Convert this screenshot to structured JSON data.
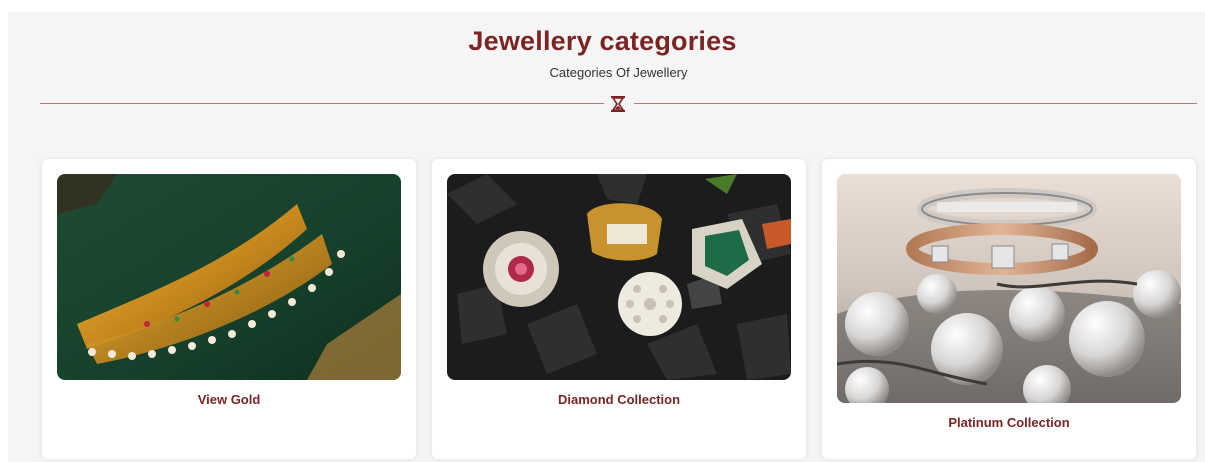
{
  "header": {
    "title": "Jewellery categories",
    "subtitle": "Categories Of Jewellery",
    "divider_icon": "hourglass-icon",
    "accent_color": "#7a2524"
  },
  "categories": [
    {
      "label": "View Gold",
      "image": "gold-choker-necklace"
    },
    {
      "label": "Diamond Collection",
      "image": "diamond-rings-on-stones"
    },
    {
      "label": "Platinum Collection",
      "image": "platinum-rings-with-pearls"
    }
  ]
}
